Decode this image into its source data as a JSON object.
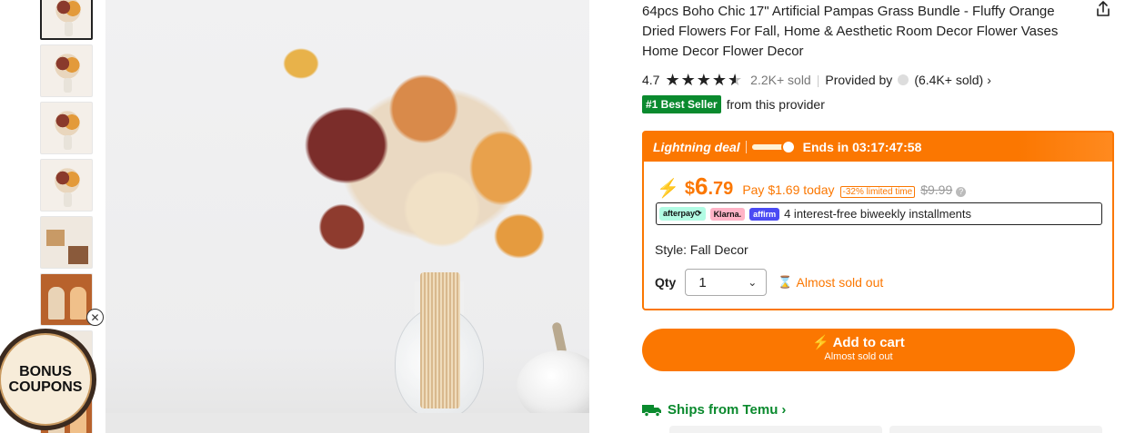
{
  "gallery": {
    "thumbnails": [
      "flower",
      "flower",
      "flower",
      "flower",
      "collage",
      "orange",
      "collage",
      "orange"
    ],
    "selected_index": 0
  },
  "promo": {
    "bonus_line1": "BONUS",
    "bonus_line2": "COUPONS",
    "close_icon": "close-icon"
  },
  "product": {
    "title": "64pcs Boho Chic 17\" Artificial Pampas Grass Bundle - Fluffy Orange Dried Flowers For Fall, Home & Aesthetic Room Decor Flower Vases Home Decor Flower Decor",
    "rating": "4.7",
    "stars_value": 4.7,
    "sold": "2.2K+ sold",
    "provided_by": "Provided by",
    "provider_sold": "(6.4K+ sold)",
    "provider_chevron": "›",
    "best_seller_badge": "#1 Best Seller",
    "best_seller_suffix": "from this provider"
  },
  "deal": {
    "label": "Lightning deal",
    "progress_fraction": 0.85,
    "ends_in": "Ends in 03:17:47:58",
    "currency": "$",
    "price_int": "6",
    "price_dec": ".79",
    "pay_today": "Pay $1.69 today",
    "discount_tag": "-32% limited time",
    "original_price": "$9.99",
    "installments_text": "4 interest-free biweekly installments",
    "payment_badges": [
      "afterpay⟳",
      "Klarna.",
      "affirm"
    ],
    "style_label": "Style:",
    "style_value": "Fall Decor",
    "qty_label": "Qty",
    "qty_value": "1",
    "stock_status": "Almost sold out",
    "accent_color": "#fb7701"
  },
  "cart": {
    "label": "Add to cart",
    "sublabel": "Almost sold out"
  },
  "shipping": {
    "label": "Ships from Temu",
    "chevron": "›",
    "color": "#0a8a2e"
  }
}
